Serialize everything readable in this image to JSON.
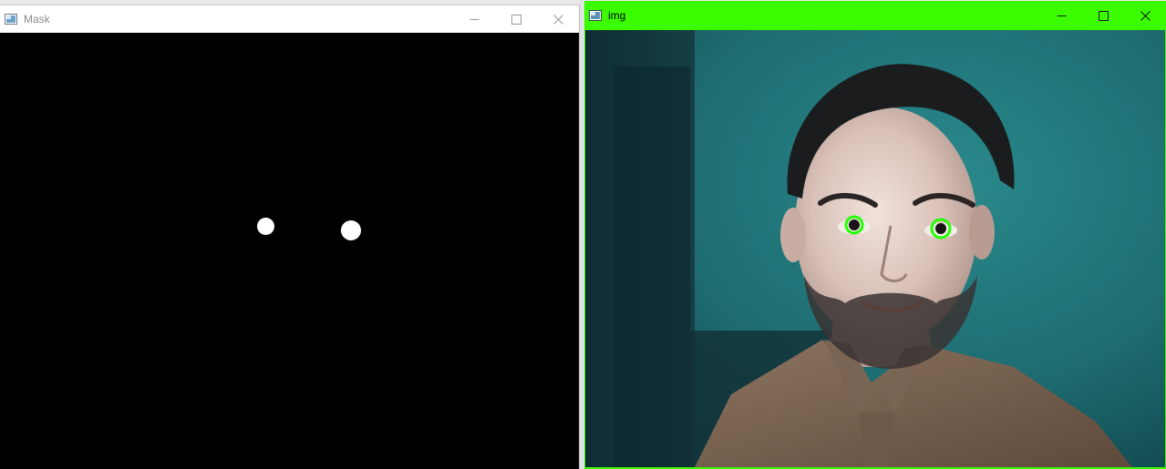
{
  "windows": {
    "mask": {
      "title": "Mask",
      "controls": {
        "minimize": "minimize-icon",
        "maximize": "maximize-icon",
        "close": "close-icon"
      }
    },
    "img": {
      "title": "img",
      "controls": {
        "minimize": "minimize-icon",
        "maximize": "maximize-icon",
        "close": "close-icon"
      }
    }
  },
  "colors": {
    "img_titlebar": "#3cfd00",
    "eye_ring": "#22ff00",
    "mask_background": "#000000",
    "mask_blob": "#ffffff",
    "camera_wall": "#1f6f73"
  }
}
